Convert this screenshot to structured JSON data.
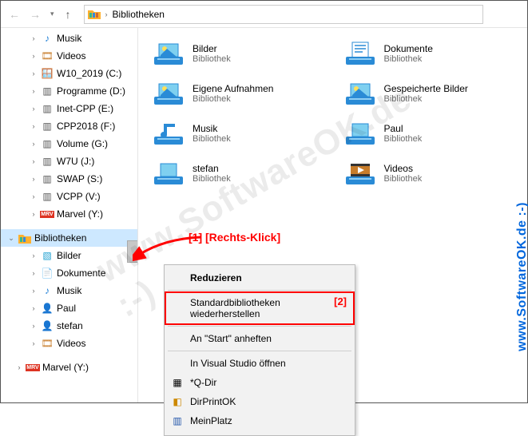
{
  "breadcrumb": {
    "root": "Bibliotheken"
  },
  "annotations": {
    "anno1": "[1]  [Rechts-Klick]",
    "anno2": "[2]"
  },
  "watermark": "www.SoftwareOK.de :-)",
  "sidebar": {
    "items": [
      {
        "label": "Musik",
        "icon": "music-icon"
      },
      {
        "label": "Videos",
        "icon": "video-icon"
      },
      {
        "label": "W10_2019 (C:)",
        "icon": "drive-w10-icon"
      },
      {
        "label": "Programme (D:)",
        "icon": "drive-icon"
      },
      {
        "label": "Inet-CPP (E:)",
        "icon": "drive-icon"
      },
      {
        "label": "CPP2018 (F:)",
        "icon": "drive-icon"
      },
      {
        "label": "Volume (G:)",
        "icon": "drive-icon"
      },
      {
        "label": "W7U (J:)",
        "icon": "drive-icon"
      },
      {
        "label": "SWAP (S:)",
        "icon": "drive-icon"
      },
      {
        "label": "VCPP (V:)",
        "icon": "drive-icon"
      },
      {
        "label": "Marvel (Y:)",
        "icon": "marvel-icon"
      }
    ],
    "selected": {
      "label": "Bibliotheken"
    },
    "libs": [
      {
        "label": "Bilder",
        "icon": "pictures-icon"
      },
      {
        "label": "Dokumente",
        "icon": "documents-icon"
      },
      {
        "label": "Musik",
        "icon": "music-icon"
      },
      {
        "label": "Paul",
        "icon": "user-icon"
      },
      {
        "label": "stefan",
        "icon": "user-icon"
      },
      {
        "label": "Videos",
        "icon": "video-icon"
      }
    ],
    "footer": {
      "label": "Marvel (Y:)"
    }
  },
  "libraries": {
    "subtitle": "Bibliothek",
    "items": [
      {
        "name": "Bilder",
        "icon": "pictures"
      },
      {
        "name": "Dokumente",
        "icon": "documents"
      },
      {
        "name": "Eigene Aufnahmen",
        "icon": "pictures"
      },
      {
        "name": "Gespeicherte Bilder",
        "icon": "pictures"
      },
      {
        "name": "Musik",
        "icon": "music"
      },
      {
        "name": "Paul",
        "icon": "generic"
      },
      {
        "name": "stefan",
        "icon": "generic"
      },
      {
        "name": "Videos",
        "icon": "videos"
      }
    ]
  },
  "context_menu": {
    "items": [
      {
        "label": "Reduzieren",
        "bold": true
      },
      {
        "label": "Standardbibliotheken wiederherstellen",
        "highlight": true
      },
      {
        "label": "An \"Start\" anheften"
      },
      {
        "label": "In Visual Studio öffnen"
      },
      {
        "label": "*Q-Dir",
        "icon": "qdir"
      },
      {
        "label": "DirPrintOK",
        "icon": "dpo"
      },
      {
        "label": "MeinPlatz",
        "icon": "mp"
      }
    ]
  }
}
